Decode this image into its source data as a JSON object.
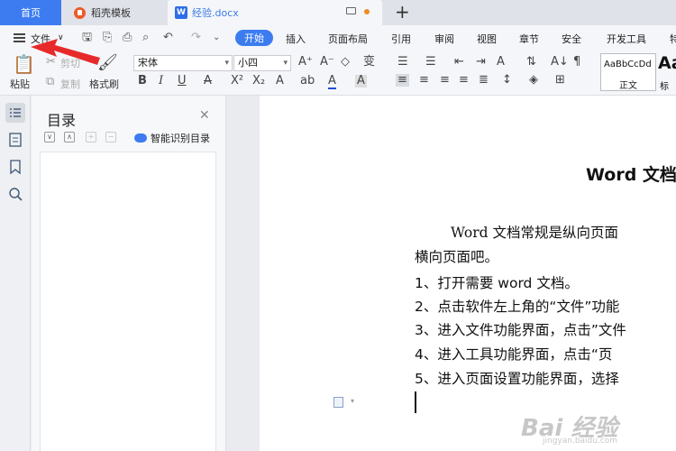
{
  "tabs": {
    "home": "首页",
    "template": "稻壳模板",
    "document": "经验.docx",
    "add": "+",
    "doc_badge": "W"
  },
  "menu": {
    "file": "文件",
    "start": "开始",
    "items": [
      "插入",
      "页面布局",
      "引用",
      "审阅",
      "视图",
      "章节",
      "安全",
      "开发工具",
      "特"
    ]
  },
  "ribbon": {
    "paste": "粘贴",
    "cut": "剪切",
    "copy": "复制",
    "format_painter": "格式刷",
    "font_name": "宋体",
    "font_size": "小四",
    "style_sample": "AaBbCcDd",
    "style_name": "正文",
    "style_next_sample": "Aa",
    "style_next_name": "标"
  },
  "toc": {
    "title": "目录",
    "smart": "智能识别目录"
  },
  "document": {
    "title": "Word 文档",
    "para1": "Word 文档常规是纵向页面",
    "para1b": "横向页面吧。",
    "steps": [
      "1、打开需要 word 文档。",
      "2、点击软件左上角的“文件”功能",
      "3、进入文件功能界面，点击”文件",
      "4、进入工具功能界面，点击“页",
      "5、进入页面设置功能界面，选择"
    ]
  },
  "watermark": {
    "main": "Bai 经验",
    "sub": "jingyan.baidu.com"
  },
  "colors": {
    "accent": "#3c7cf0",
    "annotation": "#e8292a"
  }
}
